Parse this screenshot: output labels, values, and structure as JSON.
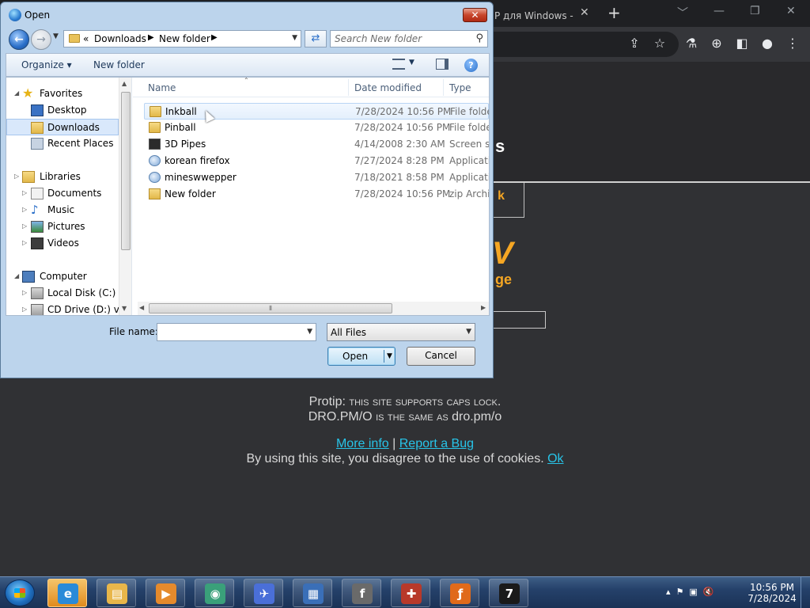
{
  "browser": {
    "tab_title": "P для Windows -",
    "tab_close": "✕",
    "new_tab": "+",
    "controls": {
      "minimize": "﹀",
      "min2": "—",
      "restore": "❐",
      "close": "✕"
    }
  },
  "page": {
    "header_fragment": "s",
    "button_fragment": "k",
    "logo_fragment": "V",
    "logo_sub": "ge",
    "protip_lead": "Protip:",
    "protip_line1": "this site supports caps lock.",
    "protip_line2_a": "DRO.PM/O",
    "protip_line2_b": "is the same as",
    "protip_line2_c": "dro.pm/o",
    "more_info": "More info",
    "separator": "|",
    "report_bug": "Report a Bug",
    "cookie_text": "By using this site, you disagree to the use of cookies.",
    "cookie_ok": "Ok"
  },
  "dialog": {
    "title": "Open",
    "close": "✕",
    "address": {
      "overflow": "«",
      "crumbs": [
        "Downloads",
        "New folder"
      ]
    },
    "search_placeholder": "Search New folder",
    "toolbar": {
      "organize": "Organize ▾",
      "new_folder": "New folder"
    },
    "nav": [
      {
        "label": "Favorites",
        "icon": "star-icon",
        "level": 0
      },
      {
        "label": "Desktop",
        "icon": "desktop-icon",
        "level": 1
      },
      {
        "label": "Downloads",
        "icon": "downloads-folder-icon",
        "level": 1,
        "selected": true
      },
      {
        "label": "Recent Places",
        "icon": "recent-places-icon",
        "level": 1
      },
      {
        "label": "Libraries",
        "icon": "libraries-icon",
        "level": 0
      },
      {
        "label": "Documents",
        "icon": "documents-icon",
        "level": 1
      },
      {
        "label": "Music",
        "icon": "music-icon",
        "level": 1
      },
      {
        "label": "Pictures",
        "icon": "pictures-icon",
        "level": 1
      },
      {
        "label": "Videos",
        "icon": "videos-icon",
        "level": 1
      },
      {
        "label": "Computer",
        "icon": "computer-icon",
        "level": 0
      },
      {
        "label": "Local Disk (C:)",
        "icon": "disk-icon",
        "level": 1
      },
      {
        "label": "CD Drive (D:) virt",
        "icon": "cd-drive-icon",
        "level": 1
      }
    ],
    "columns": {
      "name": "Name",
      "date": "Date modified",
      "type": "Type"
    },
    "files": [
      {
        "name": "Inkball",
        "date": "7/28/2024 10:56 PM",
        "type": "File folder",
        "icon": "folder-icon",
        "selected": true
      },
      {
        "name": "Pinball",
        "date": "7/28/2024 10:56 PM",
        "type": "File folder",
        "icon": "folder-icon"
      },
      {
        "name": "3D Pipes",
        "date": "4/14/2008 2:30 AM",
        "type": "Screen sav",
        "icon": "screensaver-icon"
      },
      {
        "name": "korean firefox",
        "date": "7/27/2024 8:28 PM",
        "type": "Applicati",
        "icon": "application-icon"
      },
      {
        "name": "mineswwepper",
        "date": "7/18/2021 8:58 PM",
        "type": "Applicati",
        "icon": "application-icon"
      },
      {
        "name": "New folder",
        "date": "7/28/2024 10:56 PM",
        "type": "zip Archiv",
        "icon": "zip-archive-icon"
      }
    ],
    "file_name_label": "File name:",
    "file_name_value": "",
    "filter_value": "All Files",
    "open_label": "Open",
    "cancel_label": "Cancel"
  },
  "taskbar": {
    "apps": [
      {
        "name": "internet-explorer-icon",
        "glyph": "e",
        "color": "#2a8ad8",
        "active": true
      },
      {
        "name": "file-explorer-icon",
        "glyph": "▤",
        "color": "#e8b64a"
      },
      {
        "name": "media-player-icon",
        "glyph": "▶",
        "color": "#e58a2c"
      },
      {
        "name": "globe-app-icon",
        "glyph": "◉",
        "color": "#3aa07a"
      },
      {
        "name": "airplane-app-icon",
        "glyph": "✈",
        "color": "#4a6fd8"
      },
      {
        "name": "network-app-icon",
        "glyph": "▦",
        "color": "#3a6fb8"
      },
      {
        "name": "flash-icon",
        "glyph": "f",
        "color": "#6a6a6a"
      },
      {
        "name": "toolbox-icon",
        "glyph": "✚",
        "color": "#b8392a"
      },
      {
        "name": "firefox-icon",
        "glyph": "ƒ",
        "color": "#e06a1a"
      },
      {
        "name": "terminal-app-icon",
        "glyph": "7",
        "color": "#1a1a1a"
      }
    ],
    "time": "10:56 PM",
    "date": "7/28/2024"
  }
}
